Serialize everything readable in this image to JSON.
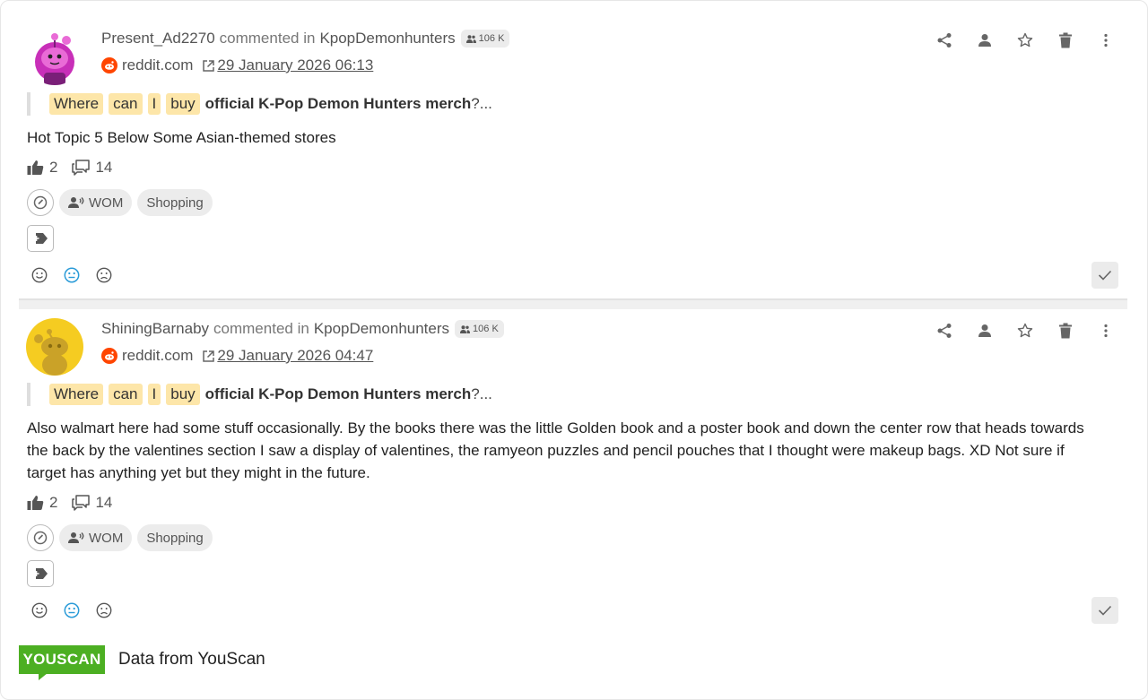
{
  "posts": [
    {
      "author": "Present_Ad2270",
      "action_text": "commented in",
      "community": "KpopDemonhunters",
      "audience": "106 K",
      "source": "reddit.com",
      "date": "29 January 2026 06:13",
      "quote": {
        "highlights": [
          "Where",
          "can",
          "I",
          "buy"
        ],
        "bold": "official K-Pop Demon Hunters merch",
        "tail": "?..."
      },
      "text": "Hot Topic 5 Below Some Asian-themed stores",
      "likes": "2",
      "comments": "14",
      "tags": [
        "WOM",
        "Shopping"
      ],
      "avatar_icon": "snoo-pink-avatar-icon"
    },
    {
      "author": "ShiningBarnaby",
      "action_text": "commented in",
      "community": "KpopDemonhunters",
      "audience": "106 K",
      "source": "reddit.com",
      "date": "29 January 2026 04:47",
      "quote": {
        "highlights": [
          "Where",
          "can",
          "I",
          "buy"
        ],
        "bold": "official K-Pop Demon Hunters merch",
        "tail": "?..."
      },
      "text": "Also walmart here had some stuff occasionally. By the books there was the little Golden book and a poster book and down the center row that heads towards the back by the valentines section I saw a display of valentines, the ramyeon puzzles and pencil pouches that I thought were makeup bags. XD Not sure if target has anything yet but they might in the future.",
      "likes": "2",
      "comments": "14",
      "tags": [
        "WOM",
        "Shopping"
      ],
      "avatar_icon": "snoo-yellow-avatar-icon"
    }
  ],
  "footer": {
    "logo": "YOUSCAN",
    "text": "Data from YouScan"
  },
  "colors": {
    "highlight": "#fde6a9",
    "reddit": "#ff4500",
    "brand_green": "#4caf22",
    "neutral_sentiment": "#2a9bd8"
  }
}
